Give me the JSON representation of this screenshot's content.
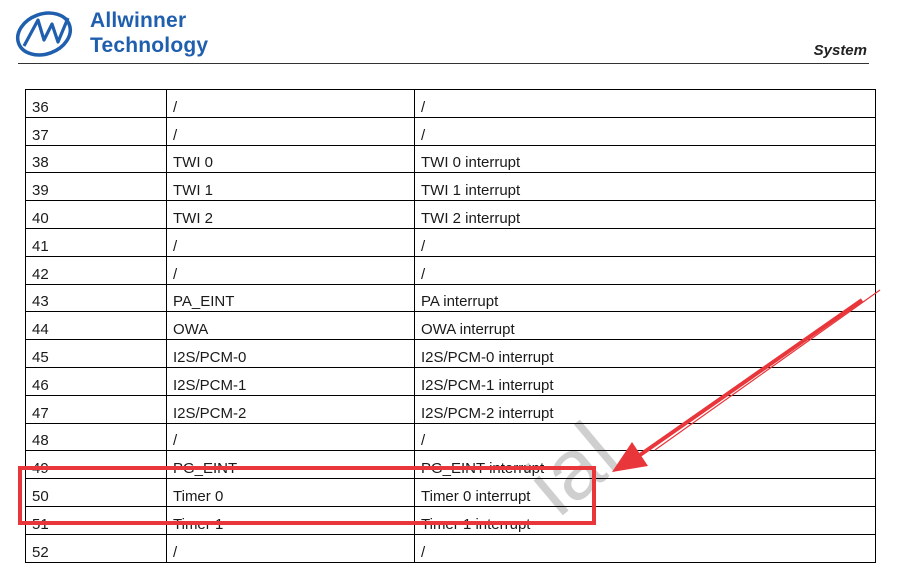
{
  "header": {
    "brand_line1": "Allwinner",
    "brand_line2": "Technology",
    "section": "System"
  },
  "watermark": "ial",
  "table": {
    "rows": [
      [
        "36",
        "/",
        "/"
      ],
      [
        "37",
        "/",
        "/"
      ],
      [
        "38",
        "TWI 0",
        "TWI 0 interrupt"
      ],
      [
        "39",
        "TWI 1",
        "TWI 1 interrupt"
      ],
      [
        "40",
        "TWI 2",
        "TWI 2 interrupt"
      ],
      [
        "41",
        "/",
        "/"
      ],
      [
        "42",
        "/",
        "/"
      ],
      [
        "43",
        "PA_EINT",
        "PA interrupt"
      ],
      [
        "44",
        "OWA",
        "OWA interrupt"
      ],
      [
        "45",
        "I2S/PCM-0",
        "I2S/PCM-0 interrupt"
      ],
      [
        "46",
        "I2S/PCM-1",
        "I2S/PCM-1 interrupt"
      ],
      [
        "47",
        "I2S/PCM-2",
        "I2S/PCM-2 interrupt"
      ],
      [
        "48",
        "/",
        "/"
      ],
      [
        "49",
        "PG_EINT",
        "PG_EINT interrupt"
      ],
      [
        "50",
        "Timer 0",
        "Timer 0 interrupt"
      ],
      [
        "51",
        "Timer 1",
        "Timer 1 interrupt"
      ],
      [
        "52",
        "/",
        "/"
      ]
    ]
  },
  "annotation": {
    "color": "#e8363b",
    "highlighted_rows": [
      "50",
      "51"
    ]
  }
}
